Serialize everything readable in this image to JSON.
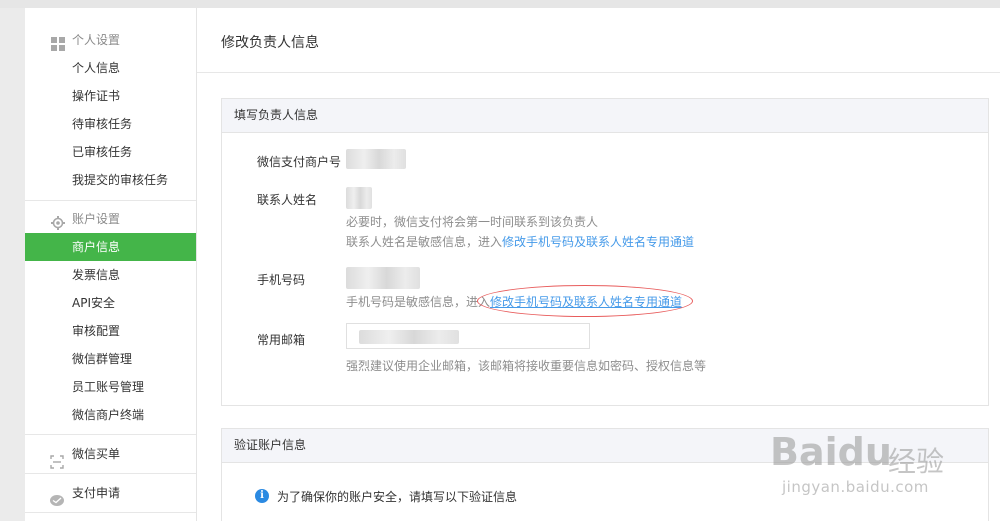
{
  "sidebar": {
    "group_personal": {
      "label": "个人设置",
      "icon": "grid-icon",
      "items": [
        {
          "label": "个人信息"
        },
        {
          "label": "操作证书"
        },
        {
          "label": "待审核任务"
        },
        {
          "label": "已审核任务"
        },
        {
          "label": "我提交的审核任务"
        }
      ]
    },
    "group_account": {
      "label": "账户设置",
      "icon": "gear-icon",
      "items": [
        {
          "label": "商户信息",
          "active": true
        },
        {
          "label": "发票信息"
        },
        {
          "label": "API安全"
        },
        {
          "label": "审核配置"
        },
        {
          "label": "微信群管理"
        },
        {
          "label": "员工账号管理"
        },
        {
          "label": "微信商户终端"
        }
      ]
    },
    "wechat_order": {
      "label": "微信买单",
      "icon": "scan-icon"
    },
    "pay_apply": {
      "label": "支付申请",
      "icon": "chat-bubble-icon"
    }
  },
  "main": {
    "title": "修改负责人信息",
    "panel_contact": {
      "title": "填写负责人信息",
      "merchant_id_label": "微信支付商户号",
      "contact_name_label": "联系人姓名",
      "contact_name_hint1": "必要时，微信支付将会第一时间联系到该负责人",
      "contact_name_hint2_prefix": "联系人姓名是敏感信息，进入",
      "contact_name_hint2_link": "修改手机号码及联系人姓名专用通道",
      "phone_label": "手机号码",
      "phone_hint_prefix": "手机号码是敏感信息，进入",
      "phone_hint_link": "修改手机号码及联系人姓名专用通道",
      "email_label": "常用邮箱",
      "email_hint": "强烈建议使用企业邮箱，该邮箱将接收重要信息如密码、授权信息等"
    },
    "panel_verify": {
      "title": "验证账户信息",
      "info_text": "为了确保你的账户安全，请填写以下验证信息"
    }
  },
  "watermark": {
    "logo": "Baidu",
    "cn": "经验",
    "url": "jingyan.baidu.com"
  },
  "colors": {
    "active_green": "#44b549",
    "link_blue": "#459ae9",
    "annotation_red": "#e85c5c",
    "info_blue": "#2b8ae2"
  }
}
